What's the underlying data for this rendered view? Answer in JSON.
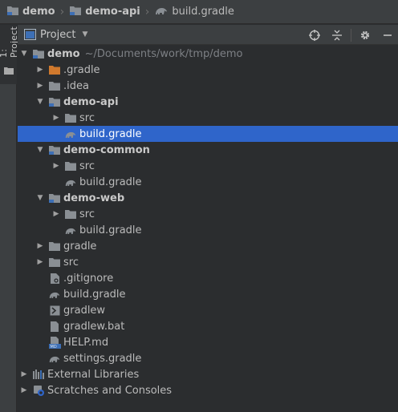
{
  "breadcrumb": {
    "items": [
      {
        "label": "demo",
        "icon": "module-folder-icon"
      },
      {
        "label": "demo-api",
        "icon": "module-folder-icon"
      },
      {
        "label": "build.gradle",
        "icon": "gradle-elephant-icon"
      }
    ]
  },
  "stripe": {
    "tab_label": "1: Project"
  },
  "panel": {
    "title": "Project",
    "icons": [
      "locate-target-icon",
      "collapse-all-icon",
      "gear-icon",
      "hide-minus-icon"
    ]
  },
  "tree": [
    {
      "label": "demo",
      "path": "~/Documents/work/tmp/demo",
      "icon": "module-folder-icon",
      "arrow": "open",
      "bold": true
    },
    {
      "label": ".gradle",
      "icon": "folder-orange-icon",
      "arrow": "closed"
    },
    {
      "label": ".idea",
      "icon": "folder-icon",
      "arrow": "closed"
    },
    {
      "label": "demo-api",
      "icon": "module-folder-icon",
      "arrow": "open",
      "bold": true
    },
    {
      "label": "src",
      "icon": "folder-icon",
      "arrow": "closed"
    },
    {
      "label": "build.gradle",
      "icon": "gradle-elephant-icon",
      "arrow": "none",
      "selected": true
    },
    {
      "label": "demo-common",
      "icon": "module-folder-icon",
      "arrow": "open",
      "bold": true
    },
    {
      "label": "src",
      "icon": "folder-icon",
      "arrow": "closed"
    },
    {
      "label": "build.gradle",
      "icon": "gradle-elephant-icon",
      "arrow": "none"
    },
    {
      "label": "demo-web",
      "icon": "module-folder-icon",
      "arrow": "open",
      "bold": true
    },
    {
      "label": "src",
      "icon": "folder-icon",
      "arrow": "closed"
    },
    {
      "label": "build.gradle",
      "icon": "gradle-elephant-icon",
      "arrow": "none"
    },
    {
      "label": "gradle",
      "icon": "folder-icon",
      "arrow": "closed"
    },
    {
      "label": "src",
      "icon": "folder-icon",
      "arrow": "closed"
    },
    {
      "label": ".gitignore",
      "icon": "gitignore-file-icon",
      "arrow": "none"
    },
    {
      "label": "build.gradle",
      "icon": "gradle-elephant-icon",
      "arrow": "none"
    },
    {
      "label": "gradlew",
      "icon": "terminal-file-icon",
      "arrow": "none"
    },
    {
      "label": "gradlew.bat",
      "icon": "text-file-icon",
      "arrow": "none"
    },
    {
      "label": "HELP.md",
      "icon": "markdown-file-icon",
      "arrow": "none"
    },
    {
      "label": "settings.gradle",
      "icon": "gradle-elephant-icon",
      "arrow": "none"
    },
    {
      "label": "External Libraries",
      "icon": "libraries-icon",
      "arrow": "closed"
    },
    {
      "label": "Scratches and Consoles",
      "icon": "scratches-icon",
      "arrow": "closed"
    }
  ],
  "colors": {
    "selection": "#2f65ca",
    "background": "#2b2d2f",
    "toolbar": "#3c3f41",
    "folder": "#8a8f94",
    "orange_folder": "#d0792d",
    "module_mark": "#3d6fb5"
  }
}
